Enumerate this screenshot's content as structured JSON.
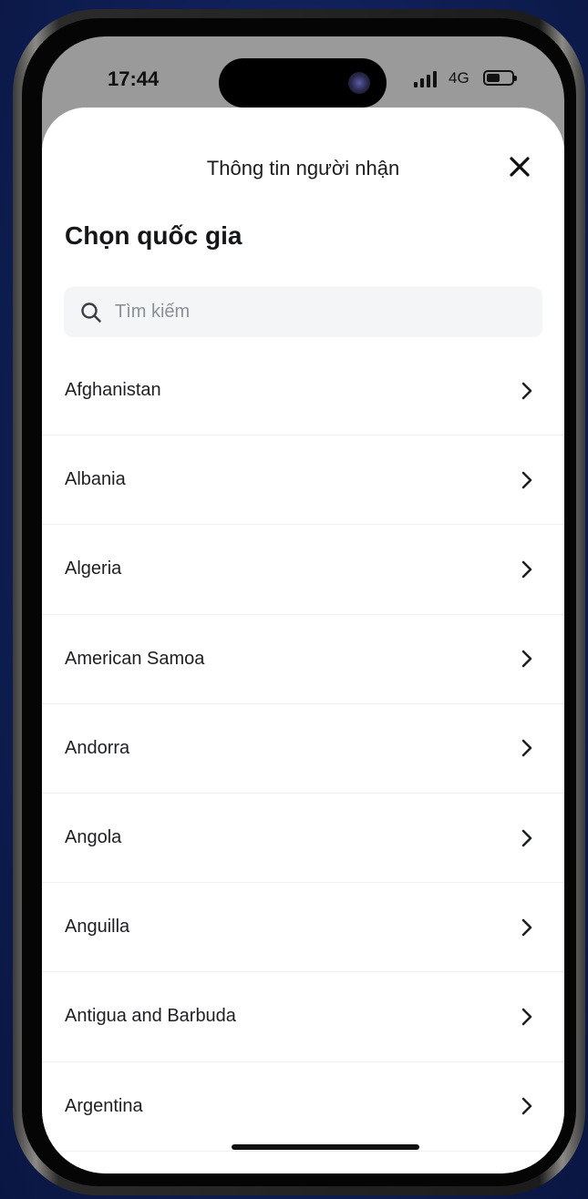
{
  "status_bar": {
    "time": "17:44",
    "network": "4G"
  },
  "header": {
    "title": "Thông tin người nhận"
  },
  "page": {
    "title": "Chọn quốc gia"
  },
  "search": {
    "placeholder": "Tìm kiếm",
    "value": ""
  },
  "countries": [
    "Afghanistan",
    "Albania",
    "Algeria",
    "American Samoa",
    "Andorra",
    "Angola",
    "Anguilla",
    "Antigua and Barbuda",
    "Argentina"
  ]
}
